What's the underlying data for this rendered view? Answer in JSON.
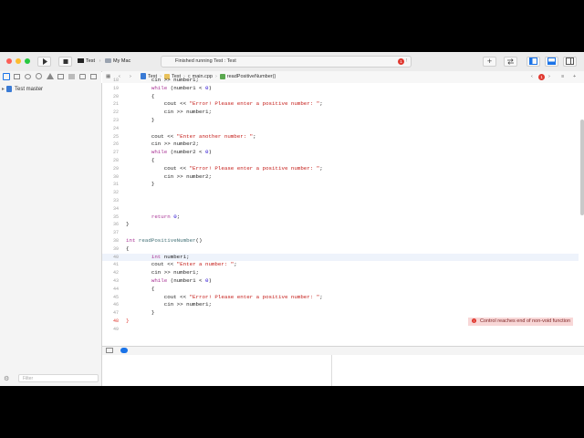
{
  "toolbar": {
    "scheme_target": "Test",
    "scheme_device": "My Mac",
    "status_text": "Finished running Test : Test",
    "error_count": "1"
  },
  "jumpbar": {
    "crumbs": [
      "Test",
      "Test",
      "main.cpp",
      "readPositiveNumber()"
    ],
    "error_count": "1"
  },
  "navigator": {
    "project_name": "Test master",
    "filter_placeholder": "Filter"
  },
  "editor": {
    "lines": [
      {
        "n": "18",
        "code": "        cin >> number1;"
      },
      {
        "n": "19",
        "code": "        while (number1 < 0)"
      },
      {
        "n": "20",
        "code": "        {"
      },
      {
        "n": "21",
        "code": "            cout << \"Error! Please enter a positive number: \";"
      },
      {
        "n": "22",
        "code": "            cin >> number1;"
      },
      {
        "n": "23",
        "code": "        }"
      },
      {
        "n": "24",
        "code": ""
      },
      {
        "n": "25",
        "code": "        cout << \"Enter another number: \";"
      },
      {
        "n": "26",
        "code": "        cin >> number2;"
      },
      {
        "n": "27",
        "code": "        while (number2 < 0)"
      },
      {
        "n": "28",
        "code": "        {"
      },
      {
        "n": "29",
        "code": "            cout << \"Error! Please enter a positive number: \";"
      },
      {
        "n": "30",
        "code": "            cin >> number2;"
      },
      {
        "n": "31",
        "code": "        }"
      },
      {
        "n": "32",
        "code": ""
      },
      {
        "n": "33",
        "code": ""
      },
      {
        "n": "34",
        "code": ""
      },
      {
        "n": "35",
        "code": "        return 0;"
      },
      {
        "n": "36",
        "code": "}"
      },
      {
        "n": "37",
        "code": ""
      },
      {
        "n": "38",
        "code": "int readPositiveNumber()"
      },
      {
        "n": "39",
        "code": "{"
      },
      {
        "n": "40",
        "code": "        int number1;"
      },
      {
        "n": "41",
        "code": "        cout << \"Enter a number: \";"
      },
      {
        "n": "42",
        "code": "        cin >> number1;"
      },
      {
        "n": "43",
        "code": "        while (number1 < 0)"
      },
      {
        "n": "44",
        "code": "        {"
      },
      {
        "n": "45",
        "code": "            cout << \"Error! Please enter a positive number: \";"
      },
      {
        "n": "46",
        "code": "            cin >> number1;"
      },
      {
        "n": "47",
        "code": "        }"
      },
      {
        "n": "48",
        "code": "}"
      },
      {
        "n": "49",
        "code": ""
      }
    ],
    "current_line": "40",
    "error_line": "48",
    "error_message": "Control reaches end of non-void function"
  },
  "colors": {
    "keyword": "#a83294",
    "string": "#c41a16",
    "number": "#1c00cf",
    "error_bg": "#f8d7d7",
    "error_dot": "#e0382f",
    "accent": "#1a73e8"
  }
}
